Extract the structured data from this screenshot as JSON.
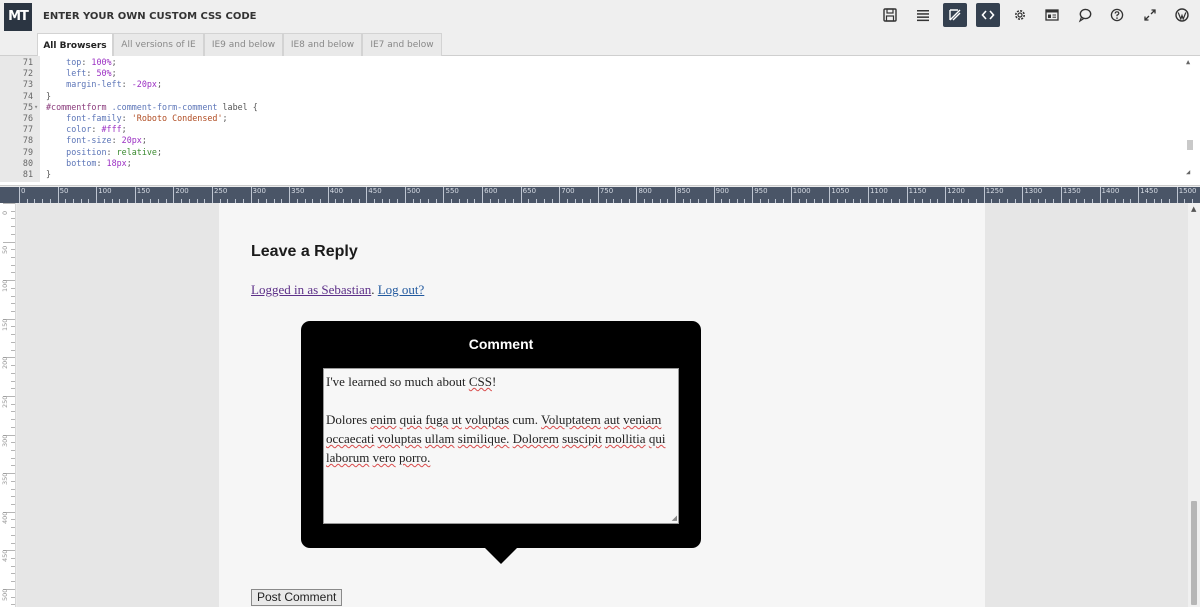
{
  "app": {
    "logo": "MT",
    "title": "ENTER YOUR OWN CUSTOM CSS CODE"
  },
  "toolbar": {
    "icons": [
      "save-icon",
      "layout-list-icon",
      "code-pen-icon",
      "code-brackets-icon",
      "settings-gear-icon",
      "page-layout-icon",
      "speech-bubble-icon",
      "help-icon",
      "fullscreen-icon",
      "wordpress-icon"
    ],
    "active": [
      "code-pen-icon",
      "code-brackets-icon"
    ],
    "accent_color": "#34404f"
  },
  "tabs": [
    {
      "label": "All Browsers",
      "active": true
    },
    {
      "label": "All versions of IE",
      "active": false
    },
    {
      "label": "IE9 and below",
      "active": false
    },
    {
      "label": "IE8 and below",
      "active": false
    },
    {
      "label": "IE7 and below",
      "active": false
    }
  ],
  "editor": {
    "lines": [
      {
        "n": "71",
        "code": [
          [
            "    ",
            ""
          ],
          [
            "top",
            "prop"
          ],
          [
            ": ",
            "plain"
          ],
          [
            "100%",
            "num"
          ],
          [
            ";",
            "plain"
          ]
        ]
      },
      {
        "n": "72",
        "code": [
          [
            "    ",
            ""
          ],
          [
            "left",
            "prop"
          ],
          [
            ": ",
            "plain"
          ],
          [
            "50%",
            "num"
          ],
          [
            ";",
            "plain"
          ]
        ]
      },
      {
        "n": "73",
        "code": [
          [
            "    ",
            ""
          ],
          [
            "margin-left",
            "prop"
          ],
          [
            ": ",
            "plain"
          ],
          [
            "-20px",
            "num"
          ],
          [
            ";",
            "plain"
          ]
        ]
      },
      {
        "n": "74",
        "code": [
          [
            "}",
            "plain"
          ]
        ]
      },
      {
        "n": "75",
        "fold": "▾",
        "code": [
          [
            "#commentform",
            "sel"
          ],
          [
            " ",
            "plain"
          ],
          [
            ".comment-form-comment",
            "prop"
          ],
          [
            " label {",
            "plain"
          ]
        ]
      },
      {
        "n": "76",
        "code": [
          [
            "    ",
            ""
          ],
          [
            "font-family",
            "prop"
          ],
          [
            ": ",
            "plain"
          ],
          [
            "'Roboto Condensed'",
            "str"
          ],
          [
            ";",
            "plain"
          ]
        ]
      },
      {
        "n": "77",
        "code": [
          [
            "    ",
            ""
          ],
          [
            "color",
            "prop"
          ],
          [
            ": ",
            "plain"
          ],
          [
            "#fff",
            "num"
          ],
          [
            ";",
            "plain"
          ]
        ]
      },
      {
        "n": "78",
        "code": [
          [
            "    ",
            ""
          ],
          [
            "font-size",
            "prop"
          ],
          [
            ": ",
            "plain"
          ],
          [
            "20px",
            "num"
          ],
          [
            ";",
            "plain"
          ]
        ]
      },
      {
        "n": "79",
        "code": [
          [
            "    ",
            ""
          ],
          [
            "position",
            "prop"
          ],
          [
            ": ",
            "plain"
          ],
          [
            "relative",
            "kw"
          ],
          [
            ";",
            "plain"
          ]
        ]
      },
      {
        "n": "80",
        "code": [
          [
            "    ",
            ""
          ],
          [
            "bottom",
            "prop"
          ],
          [
            ": ",
            "plain"
          ],
          [
            "18px",
            "num"
          ],
          [
            ";",
            "plain"
          ]
        ]
      },
      {
        "n": "81",
        "code": [
          [
            "}",
            "plain"
          ]
        ]
      }
    ]
  },
  "ruler": {
    "labels": [
      "0",
      "50",
      "100",
      "150",
      "200",
      "250",
      "300",
      "350",
      "400",
      "450",
      "500",
      "550",
      "600",
      "650",
      "700",
      "750",
      "800",
      "850",
      "900",
      "950",
      "1000",
      "1050",
      "1100",
      "1150",
      "1200",
      "1250",
      "1300",
      "1350",
      "1400",
      "1450",
      "1500"
    ],
    "vlabels": [
      "0",
      "50",
      "100",
      "150",
      "200",
      "250",
      "300",
      "350",
      "400",
      "450",
      "500"
    ]
  },
  "preview": {
    "reply_title": "Leave a Reply",
    "logged_in_link": "Logged in as Sebastian",
    "separator": ". ",
    "logout_link": "Log out?",
    "comment_label": "Comment",
    "comment_p1": "I've learned so much about CSS!",
    "comment_p2": "Dolores enim quia fuga ut voluptas cum. Voluptatem aut veniam occaecati voluptas ullam similique. Dolorem suscipit mollitia qui laborum vero porro.",
    "post_button": "Post Comment"
  }
}
